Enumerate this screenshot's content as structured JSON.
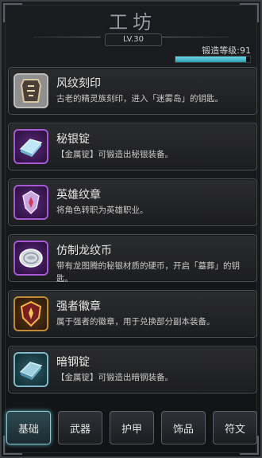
{
  "header": {
    "title": "工坊",
    "level": "LV.30",
    "forge_label": "锻造等级:91",
    "forge_progress": 0.95
  },
  "items": [
    {
      "name": "风纹刻印",
      "desc": "古老的精灵族刻印，进入「迷雾岛」的钥匙。",
      "icon": "rune-seal-icon",
      "rarity": "gray"
    },
    {
      "name": "秘银锭",
      "desc": "【金属锭】可锻造出秘银装备。",
      "icon": "mithril-ingot-icon",
      "rarity": "purple"
    },
    {
      "name": "英雄纹章",
      "desc": "将角色转职为英雄职业。",
      "icon": "hero-crest-icon",
      "rarity": "purple"
    },
    {
      "name": "仿制龙纹币",
      "desc": "带有龙图腾的秘银材质的硬币，开启「墓葬」的钥匙。",
      "icon": "dragon-coin-icon",
      "rarity": "purple"
    },
    {
      "name": "强者徽章",
      "desc": "属于强者的徽章，用于兑换部分副本装备。",
      "icon": "champion-badge-icon",
      "rarity": "gold"
    },
    {
      "name": "暗钢锭",
      "desc": "【金属锭】可锻造出暗钢装备。",
      "icon": "darksteel-ingot-icon",
      "rarity": "teal"
    }
  ],
  "tabs": [
    "基础",
    "武器",
    "护甲",
    "饰品",
    "符文"
  ],
  "active_tab": 0
}
